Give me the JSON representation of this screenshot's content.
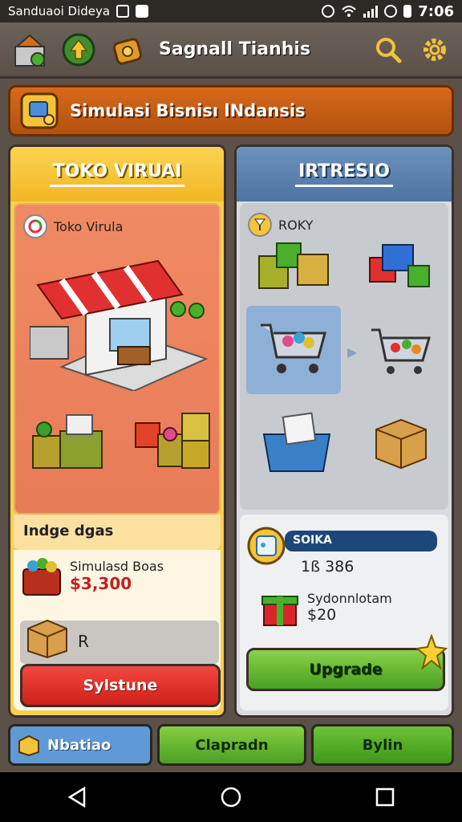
{
  "status": {
    "left_text": "Sanduaoi Dideya",
    "time": "7:06"
  },
  "appbar": {
    "title": "Sagnall Tianhis"
  },
  "banner": {
    "title": "Simulasi Bisnisı lNdansis"
  },
  "left_panel": {
    "title": "TOKO VIRUAI",
    "shop_label": "Toko Virula",
    "info_label": "Indge dgas",
    "item_name": "Simulasd Boas",
    "item_price": "$3,300",
    "slot_text": "R",
    "button_label": "Sylstune"
  },
  "right_panel": {
    "title": "IRTRESIO",
    "top_label": "ROKY",
    "stat_label": "SOIKA",
    "stat_value": "1ß 386",
    "item_name": "Sydonnlotam",
    "item_price": "$20",
    "button_label": "Upgrade"
  },
  "bottom": {
    "tab1": "Nbatiao",
    "tab2": "Clapradn",
    "tab3": "Bylin"
  },
  "colors": {
    "orange": "#c95d14",
    "yellow": "#f7cf4a",
    "blue": "#5f80ad",
    "red": "#d7271f",
    "green": "#5bb22b"
  }
}
